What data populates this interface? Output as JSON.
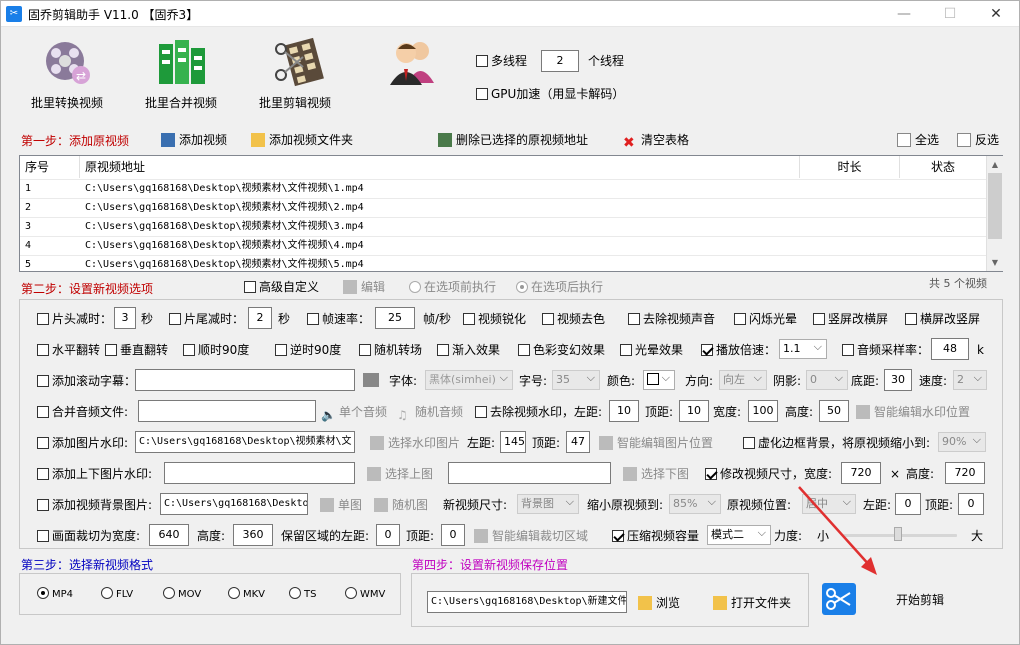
{
  "window": {
    "title": "固乔剪辑助手 V11.0  【固乔3】",
    "minimize": "—",
    "maximize": "☐",
    "close": "✕"
  },
  "toolbar": {
    "batch_convert": "批里转换视频",
    "batch_merge": "批里合并视频",
    "batch_edit": "批里剪辑视频",
    "multithread_label": "多线程",
    "thread_count": "2",
    "thread_unit": "个线程",
    "gpu_label": "GPU加速（用显卡解码）"
  },
  "step1": {
    "title": "第一步：添加原视频",
    "add_video": "添加视频",
    "add_folder": "添加视频文件夹",
    "delete_selected": "删除已选择的原视频地址",
    "clear_table": "清空表格",
    "select_all": "全选",
    "invert": "反选"
  },
  "table": {
    "columns": [
      "序号",
      "原视频地址",
      "时长",
      "状态"
    ],
    "rows": [
      {
        "no": "1",
        "path": "C:\\Users\\gq168168\\Desktop\\视频素材\\文件视频\\1.mp4",
        "duration": "",
        "status": ""
      },
      {
        "no": "2",
        "path": "C:\\Users\\gq168168\\Desktop\\视频素材\\文件视频\\2.mp4",
        "duration": "",
        "status": ""
      },
      {
        "no": "3",
        "path": "C:\\Users\\gq168168\\Desktop\\视频素材\\文件视频\\3.mp4",
        "duration": "",
        "status": ""
      },
      {
        "no": "4",
        "path": "C:\\Users\\gq168168\\Desktop\\视频素材\\文件视频\\4.mp4",
        "duration": "",
        "status": ""
      },
      {
        "no": "5",
        "path": "C:\\Users\\gq168168\\Desktop\\视频素材\\文件视频\\5.mp4",
        "duration": "",
        "status": ""
      }
    ],
    "count": "共 5 个视频"
  },
  "step2": {
    "title": "第二步：设置新视频选项",
    "advanced": "高级自定义",
    "edit": "编辑",
    "exec_before": "在选项前执行",
    "exec_after": "在选项后执行",
    "head_cut": "片头减时：",
    "head_val": "3",
    "sec": "秒",
    "tail_cut": "片尾减时：",
    "tail_val": "2",
    "frame_reduce": "帧速率：",
    "frame_val": "25",
    "fps_unit": "帧/秒",
    "sharpen": "视频锐化",
    "decolor": "视频去色",
    "remove_audio": "去除视频声音",
    "flash": "闪烁光晕",
    "v2h": "竖屏改横屏",
    "h2v": "横屏改竖屏",
    "hflip": "水平翻转",
    "vflip": "垂直翻转",
    "rot90": "顺时90度",
    "rotm90": "逆时90度",
    "random_trans": "随机转场",
    "fadein": "渐入效果",
    "color_change": "色彩变幻效果",
    "halo": "光晕效果",
    "speed": "播放倍速：",
    "speed_val": "1.1",
    "sample_rate": "音频采样率：",
    "sample_val": "48",
    "sample_unit": "k",
    "scroll_sub": "添加滚动字幕：",
    "font": "字体:",
    "font_val": "黑体(simhei)",
    "size": "字号:",
    "size_val": "35",
    "color": "颜色:",
    "direction": "方向:",
    "dir_val": "向左",
    "shadow": "阴影:",
    "shadow_val": "0",
    "bottom": "底距:",
    "bottom_val": "30",
    "spd": "速度:",
    "spd_val": "2",
    "merge_audio": "合并音频文件:",
    "single_audio": "单个音频",
    "random_audio": "随机音频",
    "remove_wm": "去除视频水印，左距:",
    "wm_left": "10",
    "top": "顶距:",
    "wm_top": "10",
    "width": "宽度:",
    "wm_w": "100",
    "height": "高度:",
    "wm_h": "50",
    "smart_wm": "智能编辑水印位置",
    "img_wm": "添加图片水印:",
    "img_wm_path": "C:\\Users\\gq168168\\Desktop\\视频素材\\文",
    "pick_wm": "选择水印图片",
    "left": "左距:",
    "img_left": "145",
    "img_top": "47",
    "smart_img": "智能编辑图片位置",
    "blur_bg": "虚化边框背景，将原视频缩小到:",
    "blur_val": "90%",
    "topbottom": "添加上下图片水印:",
    "pick_top": "选择上图",
    "pick_bottom": "选择下图",
    "resize": "修改视频尺寸，宽度:",
    "res_w": "720",
    "times": "×",
    "res_h_lbl": "高度:",
    "res_h": "720",
    "bg_img": "添加视频背景图片:",
    "bg_path": "C:\\Users\\gq168168\\Desktop",
    "single_img": "单图",
    "random_img": "随机图",
    "new_size": "新视频尺寸:",
    "size_mode": "背景图",
    "shrink": "缩小原视频到:",
    "shrink_val": "85%",
    "orig_pos": "原视频位置:",
    "pos_val": "居中",
    "pos_left": "0",
    "pos_top": "0",
    "crop": "画面裁切为宽度:",
    "crop_w": "640",
    "crop_h_lbl": "高度:",
    "crop_h": "360",
    "keep_left": "保留区域的左距:",
    "keep_left_val": "0",
    "keep_top": "0",
    "smart_crop": "智能编辑裁切区域",
    "compress": "压缩视频容量",
    "mode": "模式二",
    "force": "力度:",
    "small": "小",
    "big": "大"
  },
  "step3": {
    "title": "第三步：选择新视频格式",
    "formats": [
      "MP4",
      "FLV",
      "MOV",
      "MKV",
      "TS",
      "WMV"
    ],
    "selected": "MP4"
  },
  "step4": {
    "title": "第四步：设置新视频保存位置",
    "save_path": "C:\\Users\\gq168168\\Desktop\\新建文件",
    "browse": "浏览",
    "open_folder": "打开文件夹"
  },
  "start": "开始剪辑",
  "colors": {
    "step": "#c00000",
    "step3": "#0000c0",
    "step4": "#c000c0",
    "arrow": "#e03030"
  }
}
